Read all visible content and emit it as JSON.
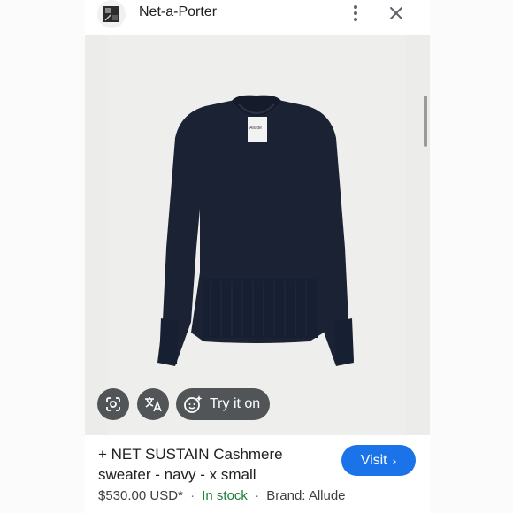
{
  "header": {
    "site_name": "Net-a-Porter"
  },
  "image_chips": {
    "try_on_label": "Try it on"
  },
  "product": {
    "title": "+ NET SUSTAIN Cashmere sweater - navy - x small",
    "price": "$530.00 USD*",
    "separator": "·",
    "stock_status": "In stock",
    "brand": "Brand: Allude",
    "garment_tag": "Allude"
  },
  "actions": {
    "visit_label": "Visit",
    "visit_chevron": "›"
  },
  "icons": {
    "menu": "more-vert-icon",
    "close": "close-icon",
    "lens": "lens-icon",
    "translate": "translate-icon",
    "try_on": "face-sparkle-icon"
  },
  "colors": {
    "accent": "#1a73e8",
    "in_stock": "#188038",
    "sweater": "#1b2233",
    "chip_bg": "#3c4043"
  }
}
